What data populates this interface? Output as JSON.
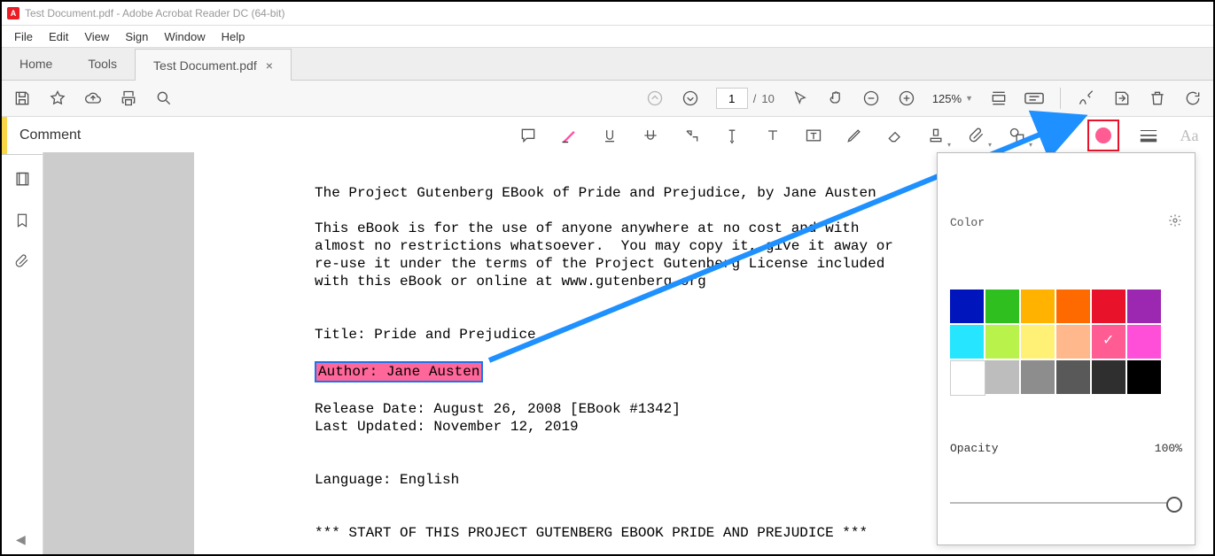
{
  "title": "Test Document.pdf - Adobe Acrobat Reader DC (64-bit)",
  "menu": {
    "file": "File",
    "edit": "Edit",
    "view": "View",
    "sign": "Sign",
    "window": "Window",
    "help": "Help"
  },
  "tabs": {
    "home": "Home",
    "tools": "Tools",
    "doc": "Test Document.pdf"
  },
  "page": {
    "current": "1",
    "sep": "/",
    "total": "10"
  },
  "zoom": {
    "value": "125%"
  },
  "commentbar": {
    "label": "Comment"
  },
  "colorpanel": {
    "title": "Color",
    "opacity_label": "Opacity",
    "opacity_value": "100%"
  },
  "colors": {
    "row1": [
      "#0015bc",
      "#2fbf1f",
      "#ffb300",
      "#ff6a00",
      "#e8132b",
      "#9c27b0"
    ],
    "row2": [
      "#26e5ff",
      "#b8f24a",
      "#fff176",
      "#ffb88c",
      "#ff5c93",
      "#ff4fd8"
    ],
    "row3": [
      "#ffffff",
      "#bdbdbd",
      "#8d8d8d",
      "#595959",
      "#2f2f2f",
      "#000000"
    ],
    "selected": "#ff5c93"
  },
  "doc": {
    "l1": "The Project Gutenberg EBook of Pride and Prejudice, by Jane Austen",
    "l2": "This eBook is for the use of anyone anywhere at no cost and with",
    "l3": "almost no restrictions whatsoever.  You may copy it, give it away or",
    "l4": "re-use it under the terms of the Project Gutenberg License included",
    "l5": "with this eBook or online at www.gutenberg.org",
    "l6": "Title: Pride and Prejudice",
    "l7": "Author: Jane Austen",
    "l8": "Release Date: August 26, 2008 [EBook #1342]",
    "l9": "Last Updated: November 12, 2019",
    "l10": "Language: English",
    "l11": "*** START OF THIS PROJECT GUTENBERG EBOOK PRIDE AND PREJUDICE ***"
  }
}
